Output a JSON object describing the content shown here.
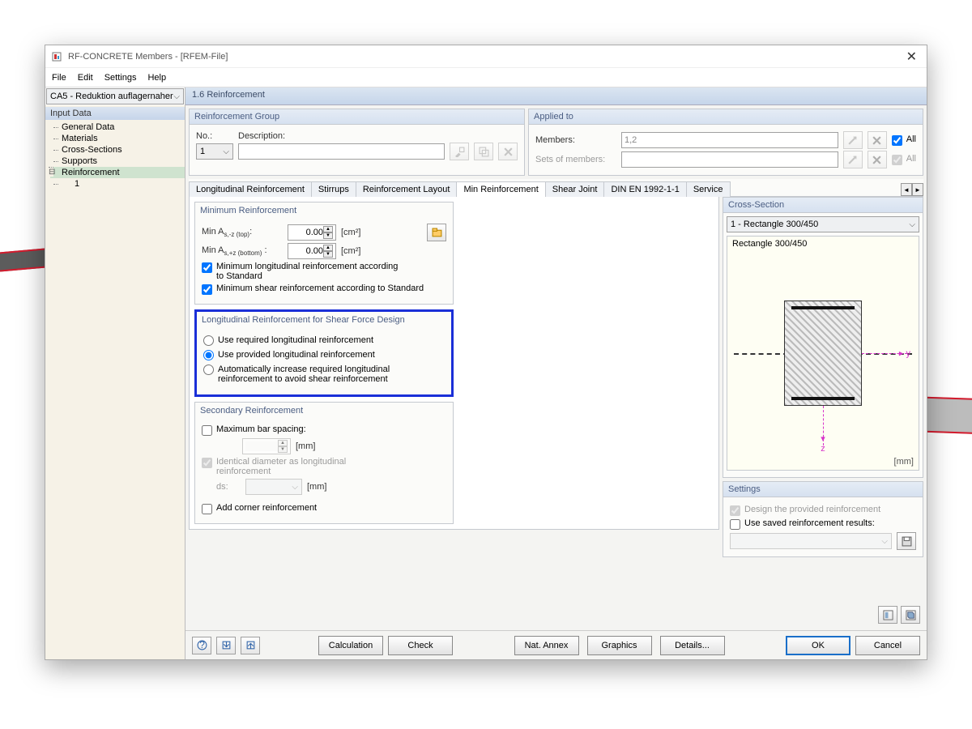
{
  "title": "RF-CONCRETE Members - [RFEM-File]",
  "menu": {
    "file": "File",
    "edit": "Edit",
    "settings": "Settings",
    "help": "Help"
  },
  "left_combo": "CA5 - Reduktion auflagernaher",
  "section_header": "1.6 Reinforcement",
  "tree": {
    "head": "Input Data",
    "items": [
      "General Data",
      "Materials",
      "Cross-Sections",
      "Supports",
      "Reinforcement"
    ],
    "child": "1"
  },
  "reinf_group": {
    "title": "Reinforcement Group",
    "no_label": "No.:",
    "no_value": "1",
    "desc_label": "Description:",
    "desc_value": ""
  },
  "applied_to": {
    "title": "Applied to",
    "members_label": "Members:",
    "members_value": "1,2",
    "sets_label": "Sets of members:",
    "sets_value": "",
    "all": "All"
  },
  "tabs": [
    "Longitudinal Reinforcement",
    "Stirrups",
    "Reinforcement Layout",
    "Min Reinforcement",
    "Shear Joint",
    "DIN EN 1992-1-1",
    "Service"
  ],
  "active_tab": 3,
  "min_reinf": {
    "title": "Minimum Reinforcement",
    "top_label_pre": "Min A",
    "top_label_sub": "s,-z (top)",
    "top_label_suf": ":",
    "bot_label_pre": "Min A",
    "bot_label_sub": "s,+z (bottom)",
    "bot_label_suf": " :",
    "top_value": "0.00",
    "bot_value": "0.00",
    "unit": "[cm²]",
    "chk1": "Minimum longitudinal reinforcement according to Standard",
    "chk2": "Minimum shear reinforcement according to Standard"
  },
  "shear_design": {
    "title": "Longitudinal Reinforcement for Shear Force Design",
    "r1": "Use required longitudinal reinforcement",
    "r2": "Use provided longitudinal reinforcement",
    "r3": "Automatically increase required longitudinal reinforcement to avoid shear reinforcement"
  },
  "secondary": {
    "title": "Secondary Reinforcement",
    "chk_max": "Maximum bar spacing:",
    "mm": "[mm]",
    "chk_ident": "Identical diameter as longitudinal reinforcement",
    "ds": "ds:",
    "chk_corner": "Add corner reinforcement"
  },
  "cross_section": {
    "title": "Cross-Section",
    "combo": "1 - Rectangle 300/450",
    "name": "Rectangle 300/450",
    "unit": "[mm]",
    "y": "y",
    "z": "z"
  },
  "settings_box": {
    "title": "Settings",
    "chk1": "Design the provided reinforcement",
    "chk2": "Use saved reinforcement results:"
  },
  "footer": {
    "calc": "Calculation",
    "check": "Check",
    "nat": "Nat. Annex",
    "graphics": "Graphics",
    "details": "Details...",
    "ok": "OK",
    "cancel": "Cancel"
  }
}
